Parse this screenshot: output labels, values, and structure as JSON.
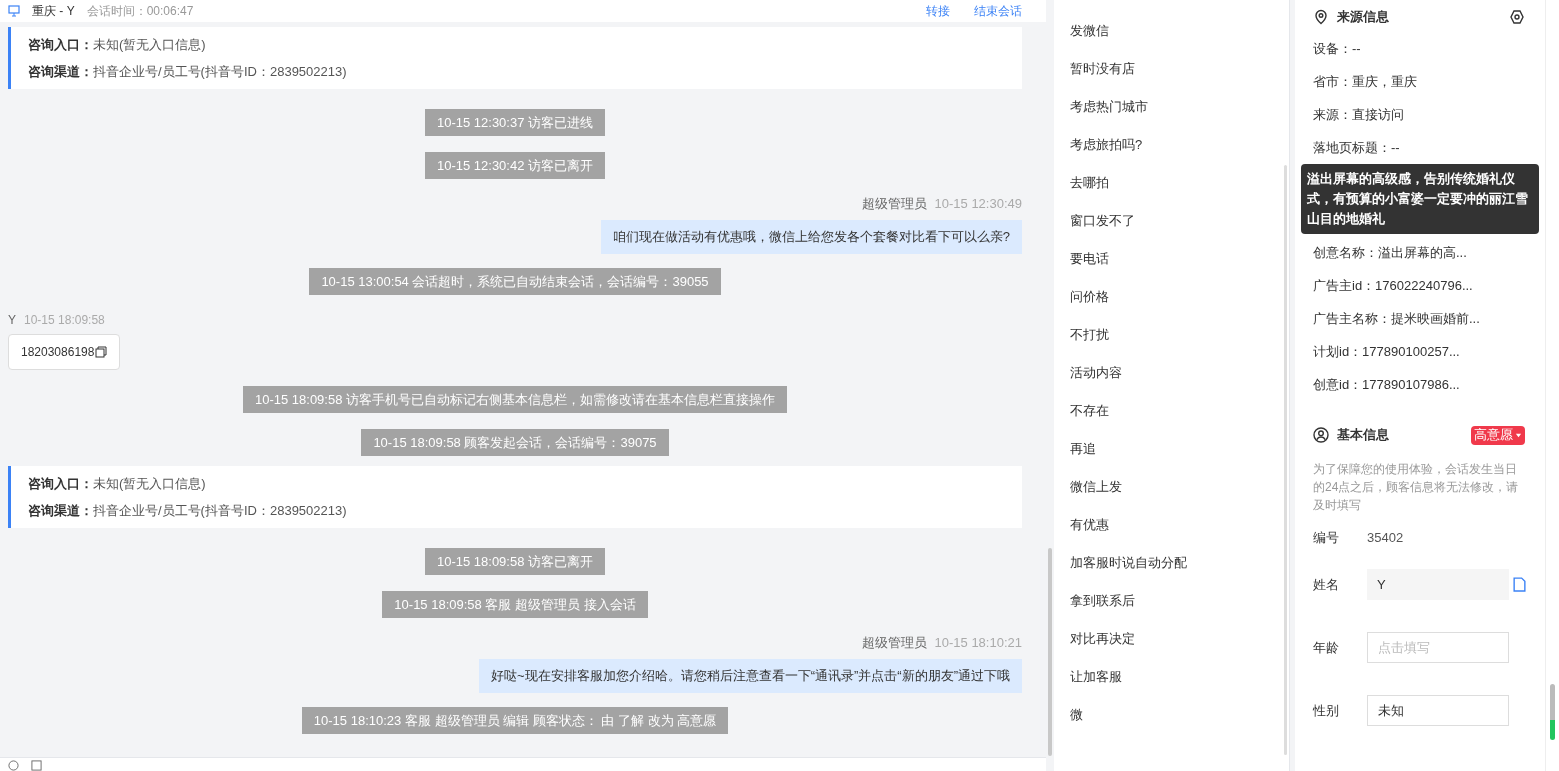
{
  "header": {
    "title": "重庆 - Y",
    "session_time": "会话时间：00:06:47",
    "actions": [
      "转接",
      "结束会话"
    ]
  },
  "messages": [
    {
      "kind": "info_card",
      "lines": [
        {
          "label": "咨询入口：",
          "value": "未知(暂无入口信息)"
        },
        {
          "label": "咨询渠道：",
          "value": "抖音企业号/员工号(抖音号ID：2839502213)"
        }
      ]
    },
    {
      "kind": "system",
      "text": "10-15 12:30:37 访客已进线"
    },
    {
      "kind": "system",
      "text": "10-15 12:30:42 访客已离开"
    },
    {
      "kind": "agent",
      "sender": "超级管理员",
      "time": "10-15 12:30:49",
      "text": "咱们现在做活动有优惠哦，微信上给您发各个套餐对比看下可以么亲?"
    },
    {
      "kind": "system",
      "text": "10-15 13:00:54 会话超时，系统已自动结束会话，会话编号：39055"
    },
    {
      "kind": "visitor",
      "sender": "Y",
      "time": "10-15 18:09:58",
      "text": "18203086198"
    },
    {
      "kind": "system",
      "text": "10-15 18:09:58 访客手机号已自动标记右侧基本信息栏，如需修改请在基本信息栏直接操作"
    },
    {
      "kind": "system",
      "text": "10-15 18:09:58 顾客发起会话，会话编号：39075"
    },
    {
      "kind": "info_card",
      "lines": [
        {
          "label": "咨询入口：",
          "value": "未知(暂无入口信息)"
        },
        {
          "label": "咨询渠道：",
          "value": "抖音企业号/员工号(抖音号ID：2839502213)"
        }
      ]
    },
    {
      "kind": "system",
      "text": "10-15 18:09:58 访客已离开"
    },
    {
      "kind": "system",
      "text": "10-15 18:09:58 客服 超级管理员 接入会话"
    },
    {
      "kind": "agent",
      "sender": "超级管理员",
      "time": "10-15 18:10:21",
      "text": "好哒~现在安排客服加您介绍哈。请您稍后注意查看一下“通讯录”并点击“新的朋友”通过下哦"
    },
    {
      "kind": "system",
      "text": "10-15 18:10:23 客服 超级管理员 编辑 顾客状态： 由 了解 改为 高意愿"
    }
  ],
  "quick_replies": [
    "发微信",
    "暂时没有店",
    "考虑热门城市",
    "考虑旅拍吗?",
    "去哪拍",
    "窗口发不了",
    "要电话",
    "问价格",
    "不打扰",
    "活动内容",
    "不存在",
    "再追",
    "微信上发",
    "有优惠",
    "加客服时说自动分配",
    "拿到联系后",
    "对比再决定",
    "让加客服",
    "微"
  ],
  "source_info": {
    "title": "来源信息",
    "items": [
      "设备：--",
      "省市：重庆，重庆",
      "来源：直接访问",
      "落地页标题：--"
    ],
    "tooltip": "溢出屏幕的高级感，告别传统婚礼仪式，有预算的小富婆一定要冲的丽江雪山目的地婚礼",
    "items_after": [
      "创意名称：溢出屏幕的高...",
      "广告主id：176022240796...",
      "广告主名称：提米映画婚前...",
      "计划id：177890100257...",
      "创意id：177890107986..."
    ]
  },
  "basic_info": {
    "title": "基本信息",
    "intent_tag": "高意愿",
    "notice": "为了保障您的使用体验，会话发生当日的24点之后，顾客信息将无法修改，请及时填写",
    "fields": [
      {
        "kind": "static",
        "label": "编号",
        "value": "35402"
      },
      {
        "kind": "readonly",
        "label": "姓名",
        "value": "Y"
      },
      {
        "kind": "input",
        "label": "年龄",
        "placeholder": "点击填写"
      },
      {
        "kind": "input",
        "label": "性别",
        "value": "未知"
      }
    ]
  }
}
